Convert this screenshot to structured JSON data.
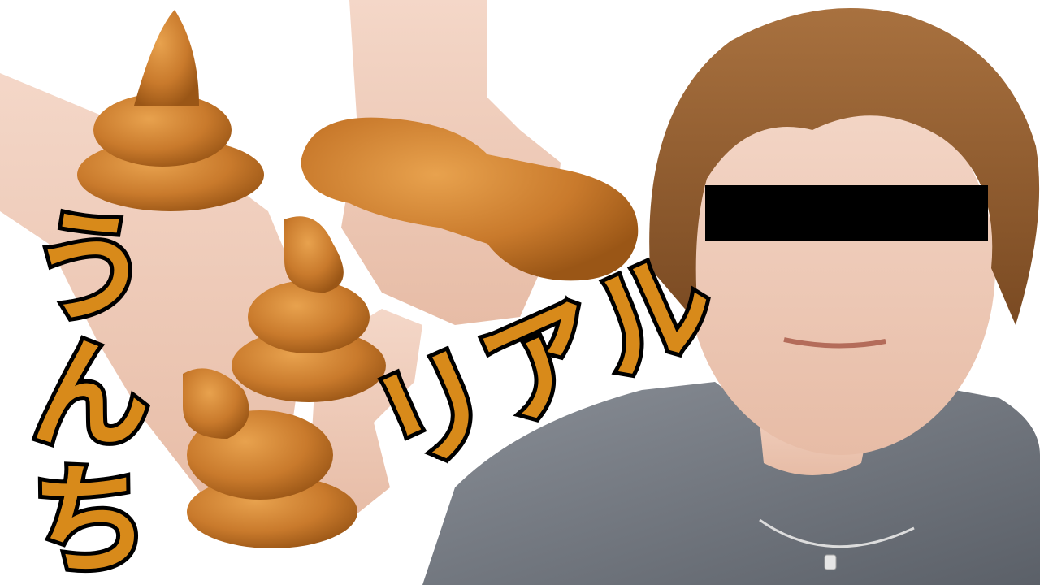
{
  "captions": {
    "vertical": "うんち",
    "diagonal": "リアル"
  },
  "colors": {
    "caption_fill": "#d88a1a",
    "caption_outline": "#000000",
    "censor_bar": "#000000",
    "background": "#ffffff"
  }
}
